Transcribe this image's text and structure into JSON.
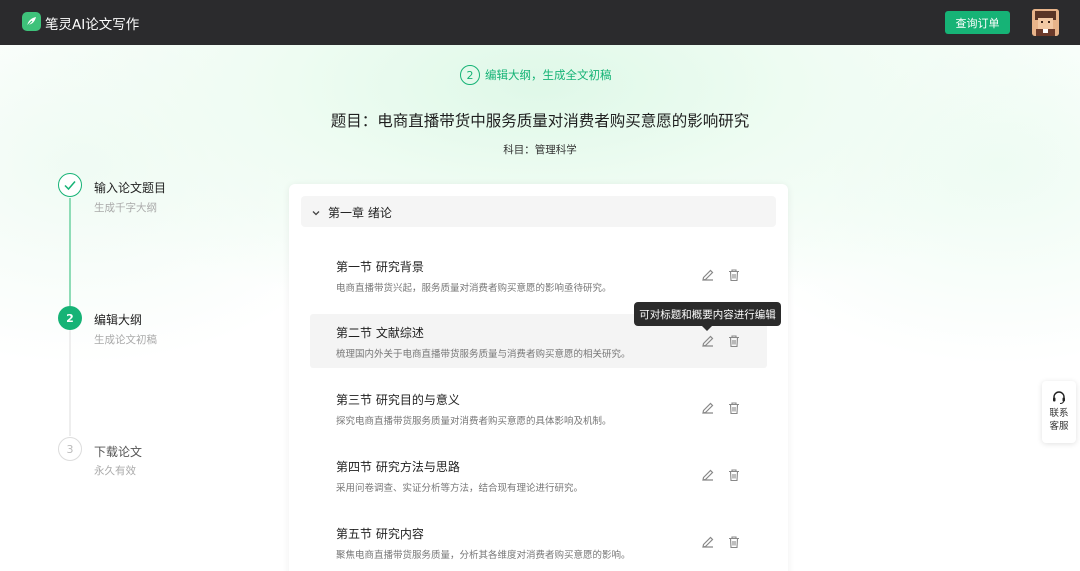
{
  "header": {
    "brand": "笔灵AI论文写作",
    "order_button": "查询订单",
    "accent_color": "#16b376"
  },
  "step_tag": {
    "number": "2",
    "text": "编辑大纲，生成全文初稿"
  },
  "paper": {
    "title": "题目：电商直播带货中服务质量对消费者购买意愿的影响研究",
    "subject": "科目：管理科学"
  },
  "stepper": {
    "steps": [
      {
        "number": "",
        "title": "输入论文题目",
        "subtitle": "生成千字大纲",
        "state": "done"
      },
      {
        "number": "2",
        "title": "编辑大纲",
        "subtitle": "生成论文初稿",
        "state": "active"
      },
      {
        "number": "3",
        "title": "下载论文",
        "subtitle": "永久有效",
        "state": "pending"
      }
    ]
  },
  "outline": {
    "chapter_title": "第一章 绪论",
    "sections": [
      {
        "title": "第一节 研究背景",
        "desc": "电商直播带货兴起，服务质量对消费者购买意愿的影响亟待研究。"
      },
      {
        "title": "第二节 文献综述",
        "desc": "梳理国内外关于电商直播带货服务质量与消费者购买意愿的相关研究。"
      },
      {
        "title": "第三节 研究目的与意义",
        "desc": "探究电商直播带货服务质量对消费者购买意愿的具体影响及机制。"
      },
      {
        "title": "第四节 研究方法与思路",
        "desc": "采用问卷调查、实证分析等方法，结合现有理论进行研究。"
      },
      {
        "title": "第五节 研究内容",
        "desc": "聚焦电商直播带货服务质量，分析其各维度对消费者购买意愿的影响。"
      }
    ]
  },
  "tooltip": "可对标题和概要内容进行编辑",
  "support": {
    "line1": "联系",
    "line2": "客服"
  }
}
